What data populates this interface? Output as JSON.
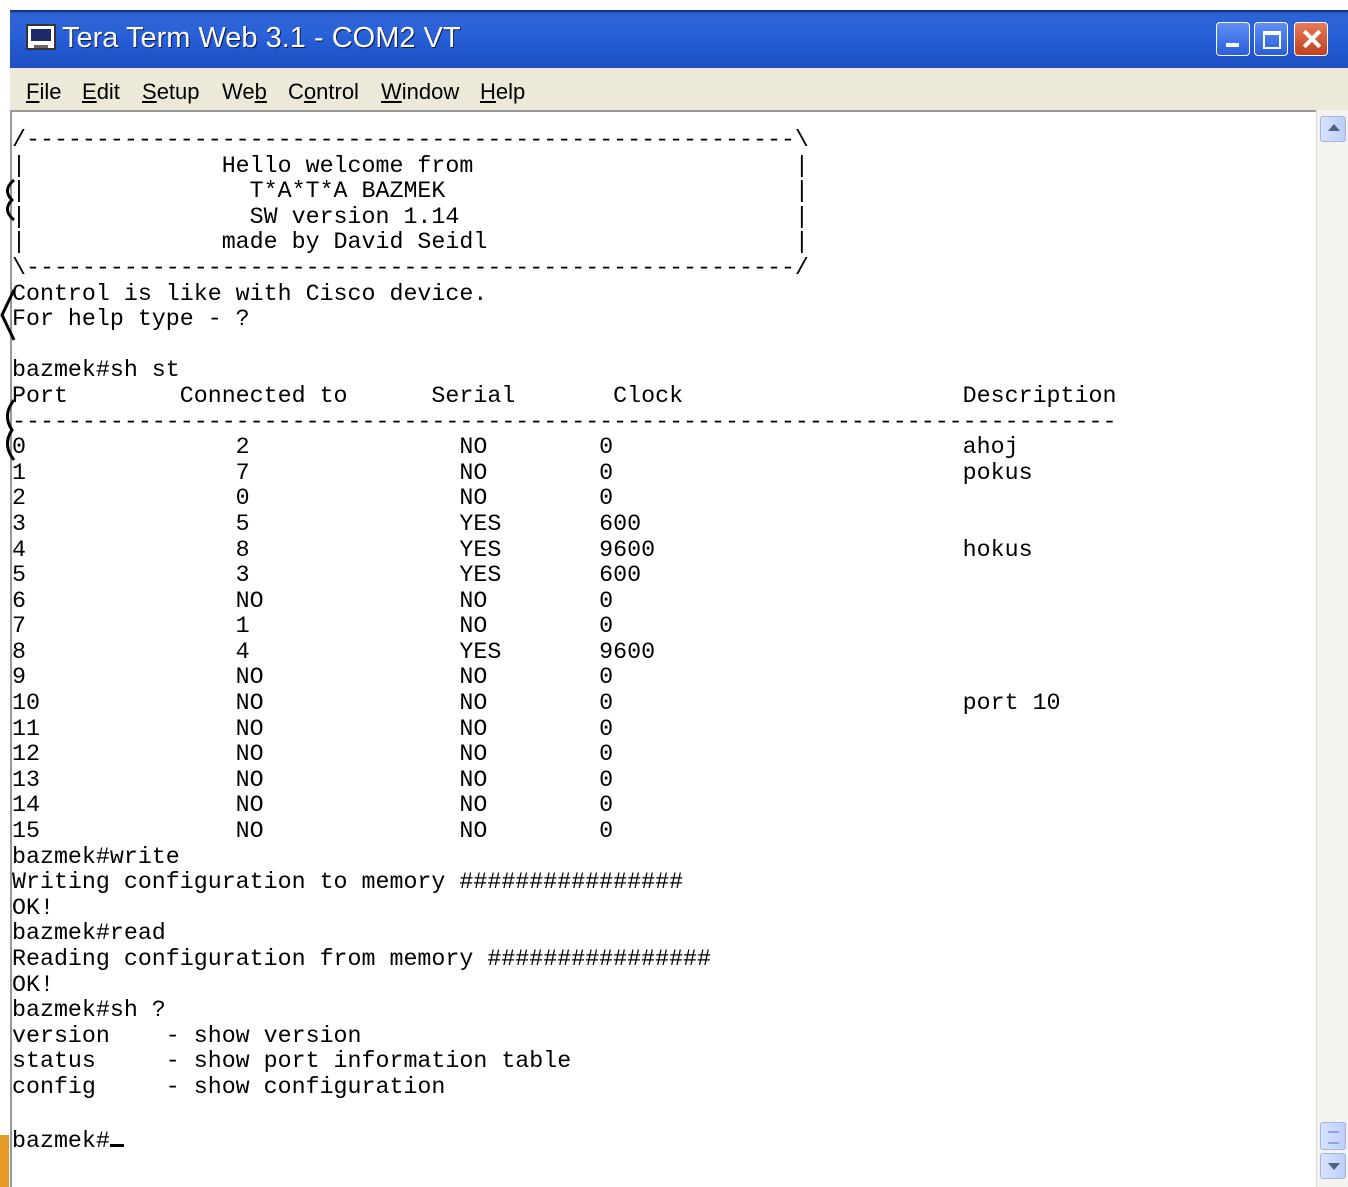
{
  "window": {
    "title": "Tera Term Web 3.1 - COM2 VT"
  },
  "menu": {
    "items": [
      {
        "label": "File",
        "hotkey": "F",
        "rest": "ile"
      },
      {
        "label": "Edit",
        "hotkey": "E",
        "rest": "dit"
      },
      {
        "label": "Setup",
        "hotkey": "S",
        "rest": "etup"
      },
      {
        "label": "Web",
        "pre": "We",
        "hotkey": "b",
        "rest": ""
      },
      {
        "label": "Control",
        "pre": "C",
        "hotkey": "o",
        "rest": "ntrol"
      },
      {
        "label": "Window",
        "hotkey": "W",
        "rest": "indow"
      },
      {
        "label": "Help",
        "hotkey": "H",
        "rest": "elp"
      }
    ]
  },
  "terminal": {
    "lines": [
      "/-------------------------------------------------------\\",
      "|              Hello welcome from                       |",
      "|                T*A*T*A BAZMEK                         |",
      "|                SW version 1.14                        |",
      "|              made by David Seidl                      |",
      "\\-------------------------------------------------------/",
      "Control is like with Cisco device.",
      "For help type - ?",
      "",
      "bazmek#sh st",
      "Port        Connected to      Serial       Clock                    Description",
      "-------------------------------------------------------------------------------",
      "0               2               NO        0                         ahoj",
      "1               7               NO        0                         pokus",
      "2               0               NO        0",
      "3               5               YES       600",
      "4               8               YES       9600                      hokus",
      "5               3               YES       600",
      "6               NO              NO        0",
      "7               1               NO        0",
      "8               4               YES       9600",
      "9               NO              NO        0",
      "10              NO              NO        0                         port 10",
      "11              NO              NO        0",
      "12              NO              NO        0",
      "13              NO              NO        0",
      "14              NO              NO        0",
      "15              NO              NO        0",
      "bazmek#write",
      "Writing configuration to memory ################",
      "OK!",
      "bazmek#read",
      "Reading configuration from memory ################",
      "OK!",
      "bazmek#sh ?",
      "version    - show version",
      "status     - show port information table",
      "config     - show configuration",
      ""
    ],
    "prompt": "bazmek#"
  },
  "colors": {
    "titlebar": "#2A62D8",
    "menubar": "#ECE9D8",
    "terminal_bg": "#FFFFFF",
    "terminal_fg": "#000000",
    "accent_orange": "#E79A27"
  }
}
